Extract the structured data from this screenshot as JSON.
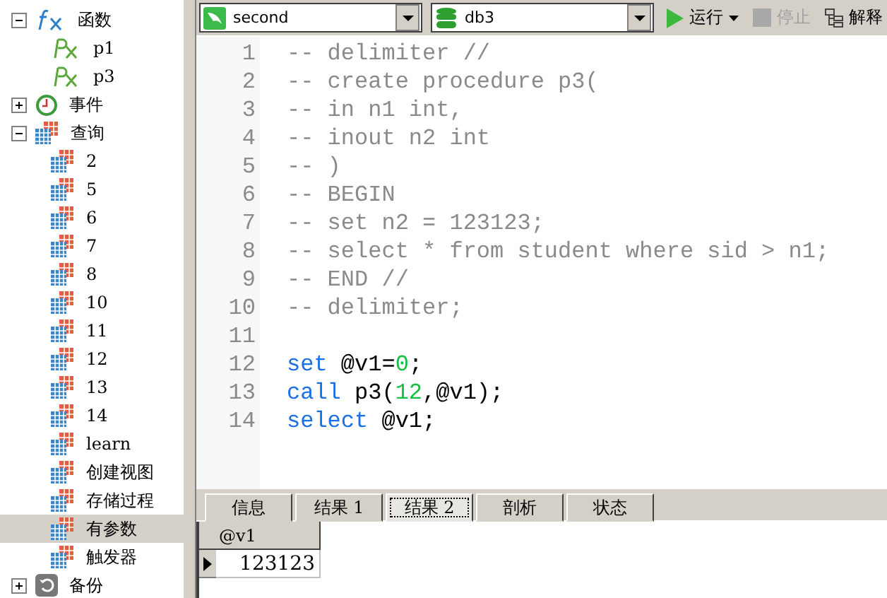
{
  "sidebar": {
    "tree": [
      {
        "label": "函数",
        "kind": "function",
        "expanded": true,
        "selected": false,
        "children": [
          {
            "label": "p1",
            "kind": "procedure",
            "selected": false
          },
          {
            "label": "p3",
            "kind": "procedure",
            "selected": false
          }
        ]
      },
      {
        "label": "事件",
        "kind": "event",
        "expanded": false,
        "selected": false
      },
      {
        "label": "查询",
        "kind": "query",
        "expanded": true,
        "selected": false,
        "children": [
          {
            "label": "2",
            "kind": "query",
            "selected": false
          },
          {
            "label": "5",
            "kind": "query",
            "selected": false
          },
          {
            "label": "6",
            "kind": "query",
            "selected": false
          },
          {
            "label": "7",
            "kind": "query",
            "selected": false
          },
          {
            "label": "8",
            "kind": "query",
            "selected": false
          },
          {
            "label": "10",
            "kind": "query",
            "selected": false
          },
          {
            "label": "11",
            "kind": "query",
            "selected": false
          },
          {
            "label": "12",
            "kind": "query",
            "selected": false
          },
          {
            "label": "13",
            "kind": "query",
            "selected": false
          },
          {
            "label": "14",
            "kind": "query",
            "selected": false
          },
          {
            "label": "learn",
            "kind": "query",
            "selected": false
          },
          {
            "label": "创建视图",
            "kind": "query",
            "selected": false
          },
          {
            "label": "存储过程",
            "kind": "query",
            "selected": false
          },
          {
            "label": "有参数",
            "kind": "query",
            "selected": true
          },
          {
            "label": "触发器",
            "kind": "query",
            "selected": false
          }
        ]
      },
      {
        "label": "备份",
        "kind": "backup",
        "expanded": false,
        "selected": false
      }
    ]
  },
  "toolbar": {
    "connection": "second",
    "database": "db3",
    "buttons": [
      {
        "kind": "run",
        "label": "运行",
        "disabled": false
      },
      {
        "kind": "stop",
        "label": "停止",
        "disabled": true
      },
      {
        "kind": "explain",
        "label": "解释",
        "disabled": false
      }
    ]
  },
  "editor": {
    "lines": [
      {
        "number": "1",
        "tokens": [
          {
            "kind": "comment",
            "text": "-- delimiter //"
          }
        ]
      },
      {
        "number": "2",
        "tokens": [
          {
            "kind": "comment",
            "text": "-- create procedure p3("
          }
        ]
      },
      {
        "number": "3",
        "tokens": [
          {
            "kind": "comment",
            "text": "-- in n1 int,"
          }
        ]
      },
      {
        "number": "4",
        "tokens": [
          {
            "kind": "comment",
            "text": "-- inout n2 int"
          }
        ]
      },
      {
        "number": "5",
        "tokens": [
          {
            "kind": "comment",
            "text": "-- )"
          }
        ]
      },
      {
        "number": "6",
        "tokens": [
          {
            "kind": "comment",
            "text": "-- BEGIN"
          }
        ]
      },
      {
        "number": "7",
        "tokens": [
          {
            "kind": "comment",
            "text": "-- set n2 = 123123;"
          }
        ]
      },
      {
        "number": "8",
        "tokens": [
          {
            "kind": "comment",
            "text": "-- select * from student where sid > n1;"
          }
        ]
      },
      {
        "number": "9",
        "tokens": [
          {
            "kind": "comment",
            "text": "-- END //"
          }
        ]
      },
      {
        "number": "10",
        "tokens": [
          {
            "kind": "comment",
            "text": "-- delimiter;"
          }
        ]
      },
      {
        "number": "11"
      },
      {
        "number": "12",
        "tokens": [
          {
            "kind": "keyword",
            "text": "set"
          },
          {
            "kind": "plain",
            "text": " @v1="
          },
          {
            "kind": "number",
            "text": "0"
          },
          {
            "kind": "plain",
            "text": ";"
          }
        ]
      },
      {
        "number": "13",
        "tokens": [
          {
            "kind": "keyword",
            "text": "call"
          },
          {
            "kind": "plain",
            "text": " p3("
          },
          {
            "kind": "number",
            "text": "12"
          },
          {
            "kind": "plain",
            "text": ",@v1);"
          }
        ]
      },
      {
        "number": "14",
        "tokens": [
          {
            "kind": "keyword",
            "text": "select"
          },
          {
            "kind": "plain",
            "text": " @v1;"
          }
        ]
      }
    ]
  },
  "results": {
    "tabs": [
      {
        "label": "信息",
        "selected": false
      },
      {
        "label": "结果 1",
        "selected": false
      },
      {
        "label": "结果 2",
        "selected": true
      },
      {
        "label": "剖析",
        "selected": false
      },
      {
        "label": "状态",
        "selected": false
      }
    ],
    "columns": [
      "@v1"
    ],
    "rows": [
      {
        "current": true,
        "cells": [
          "123123"
        ]
      }
    ]
  }
}
